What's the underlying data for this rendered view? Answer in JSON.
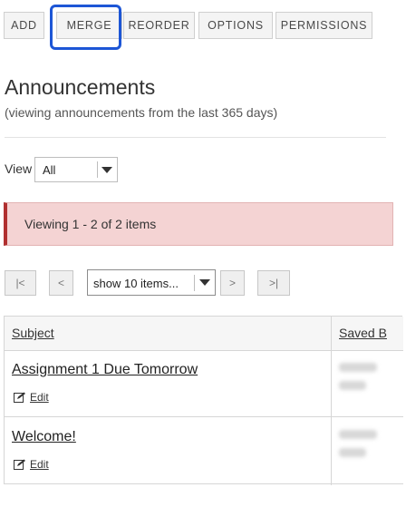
{
  "toolbar": {
    "tabs": [
      {
        "label": "ADD"
      },
      {
        "label": "MERGE"
      },
      {
        "label": "REORDER"
      },
      {
        "label": "OPTIONS"
      },
      {
        "label": "PERMISSIONS"
      }
    ],
    "highlight_color": "#1d56d6"
  },
  "page": {
    "title": "Announcements",
    "subtitle": "(viewing announcements from the last 365 days)"
  },
  "view": {
    "label": "View",
    "selected": "All"
  },
  "alert": {
    "text": "Viewing 1 - 2 of 2 items",
    "background_color": "#f4d3d3",
    "accent_color": "#b03030"
  },
  "pager": {
    "first": "|<",
    "prev": "<",
    "page_size": "show 10 items...",
    "next": ">",
    "last": ">|"
  },
  "table": {
    "headers": {
      "subject": "Subject",
      "saved_by": "Saved B"
    },
    "rows": [
      {
        "subject": "Assignment 1 Due Tomorrow",
        "edit_label": "Edit"
      },
      {
        "subject": "Welcome!",
        "edit_label": "Edit"
      }
    ]
  }
}
